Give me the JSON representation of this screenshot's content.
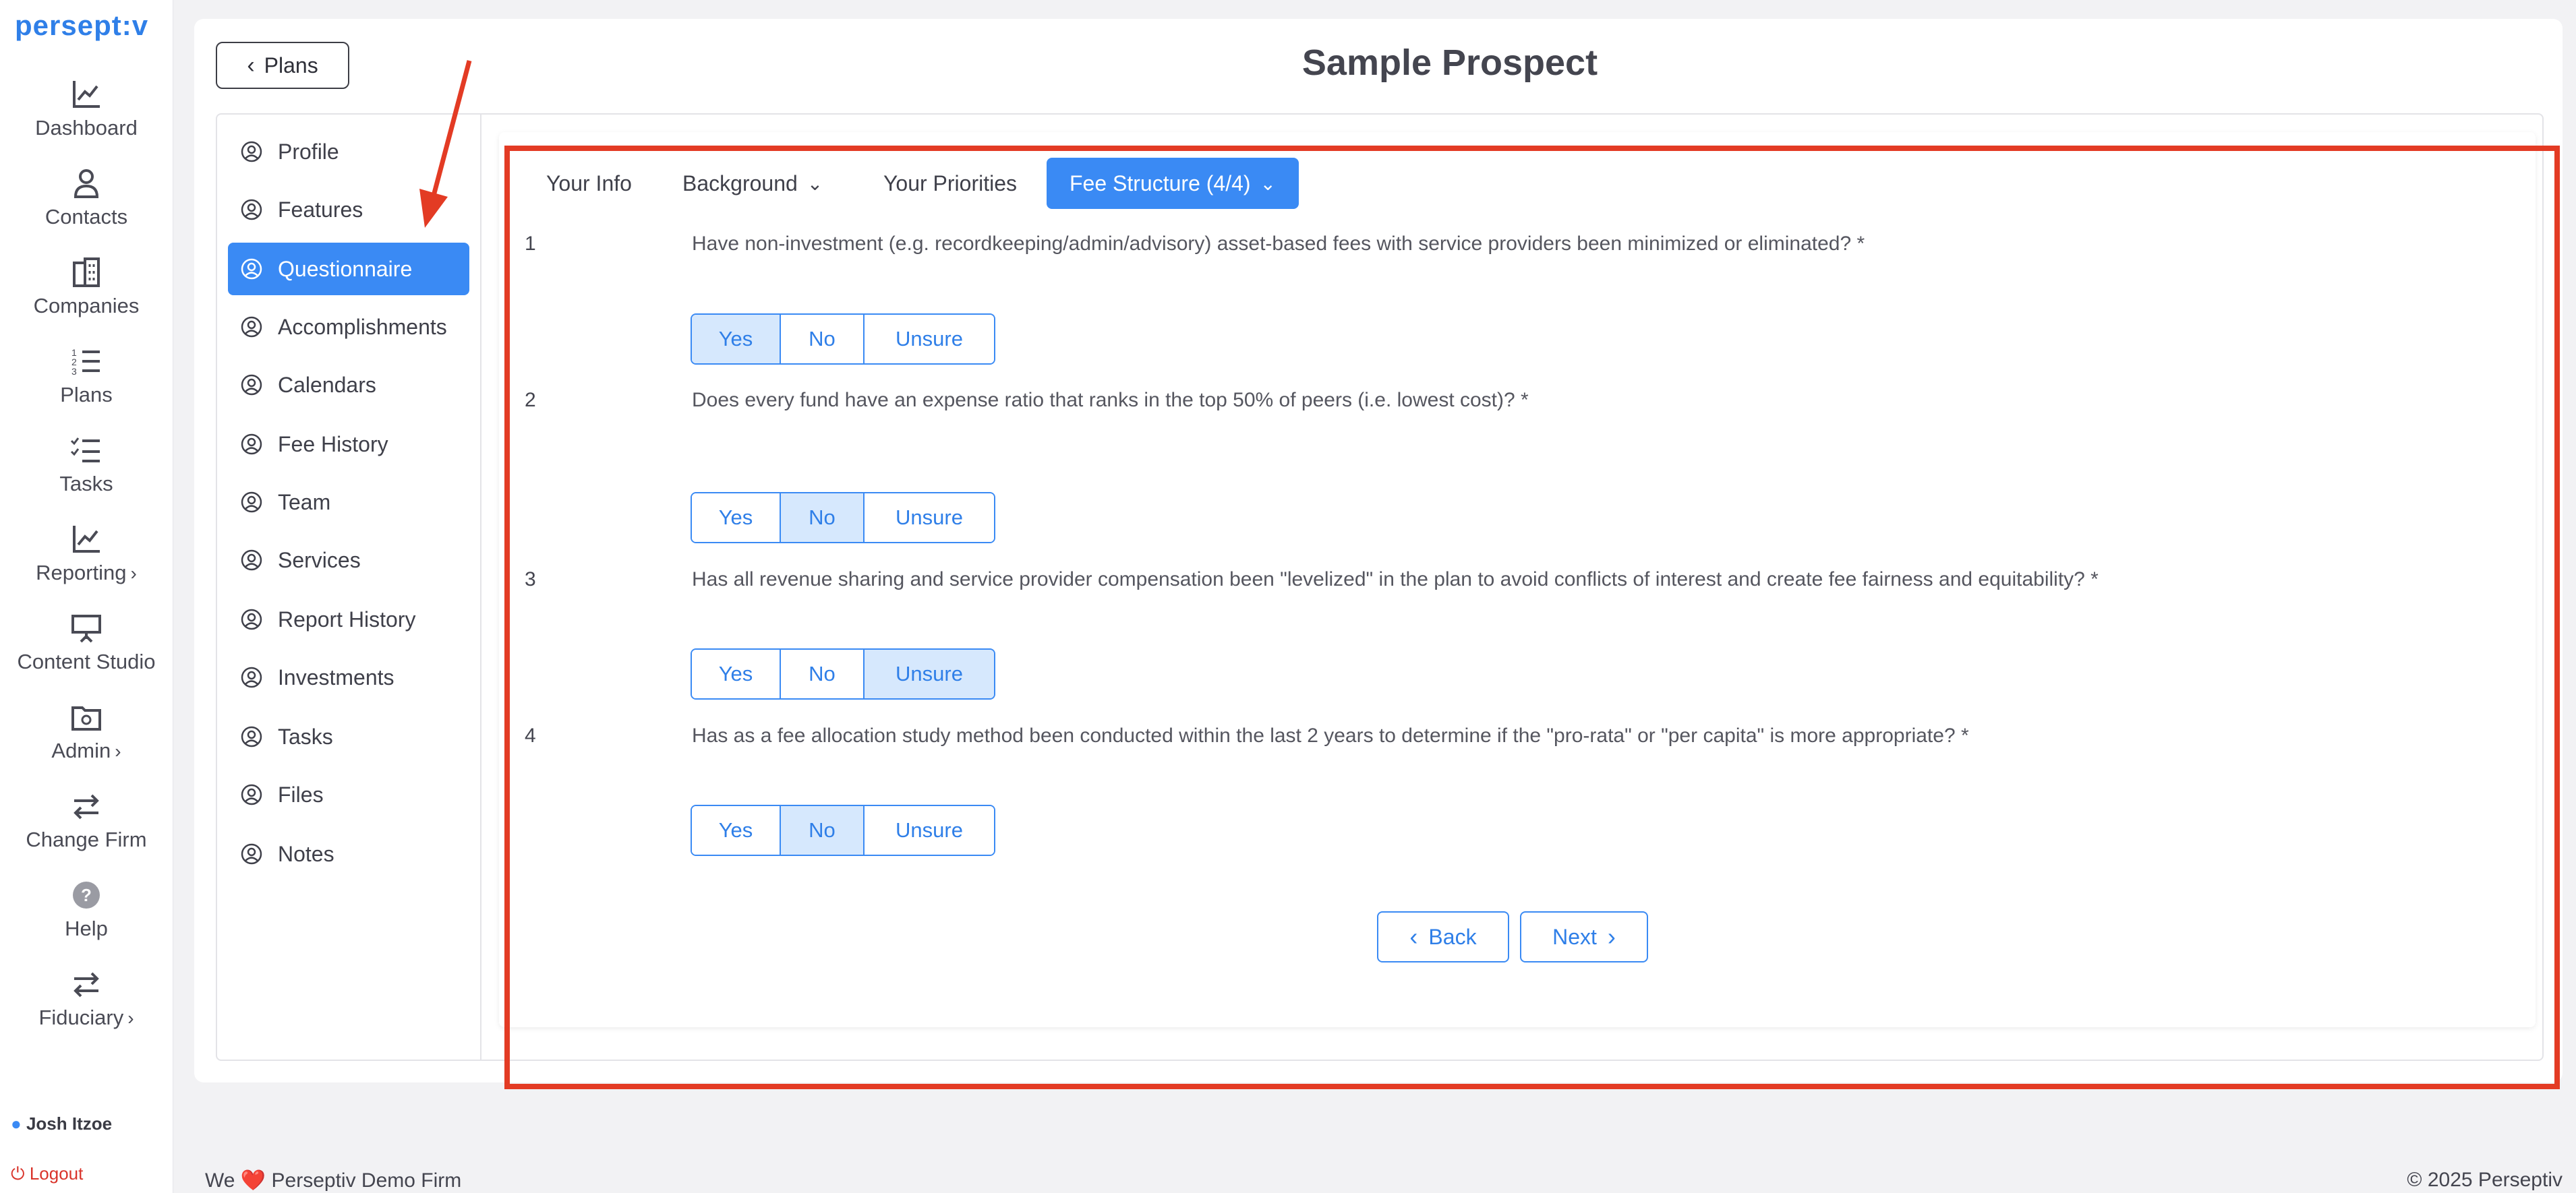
{
  "app": {
    "logo": "persept:v",
    "nav": [
      {
        "label": "Dashboard",
        "icon": "chart-line-icon"
      },
      {
        "label": "Contacts",
        "icon": "person-icon"
      },
      {
        "label": "Companies",
        "icon": "building-icon"
      },
      {
        "label": "Plans",
        "icon": "numbered-list-icon"
      },
      {
        "label": "Tasks",
        "icon": "checklist-icon"
      },
      {
        "label": "Reporting",
        "icon": "chart-line-icon",
        "chevron": "›"
      },
      {
        "label": "Content Studio",
        "icon": "presentation-icon"
      },
      {
        "label": "Admin",
        "icon": "folder-gear-icon",
        "chevron": "›"
      },
      {
        "label": "Change Firm",
        "icon": "swap-arrows-icon"
      },
      {
        "label": "Help",
        "icon": "question-circle-icon"
      },
      {
        "label": "Fiduciary",
        "icon": "swap-arrows-icon",
        "chevron": "›"
      }
    ],
    "user": "Josh Itzoe",
    "logout": "Logout"
  },
  "header": {
    "back_label": "Plans",
    "title": "Sample Prospect"
  },
  "side_menu": [
    "Profile",
    "Features",
    "Questionnaire",
    "Accomplishments",
    "Calendars",
    "Fee History",
    "Team",
    "Services",
    "Report History",
    "Investments",
    "Tasks",
    "Files",
    "Notes"
  ],
  "side_menu_active": "Questionnaire",
  "tabs": [
    {
      "label": "Your Info",
      "dropdown": false,
      "active": false
    },
    {
      "label": "Background",
      "dropdown": true,
      "active": false
    },
    {
      "label": "Your Priorities",
      "dropdown": false,
      "active": false
    },
    {
      "label": "Fee Structure (4/4)",
      "dropdown": true,
      "active": true
    }
  ],
  "questions": [
    {
      "num": "1",
      "text": "Have non-investment (e.g. recordkeeping/admin/advisory) asset-based fees with service providers been minimized or eliminated? *",
      "selected": "Yes"
    },
    {
      "num": "2",
      "text": "Does every fund have an expense ratio that ranks in the top 50% of peers (i.e. lowest cost)? *",
      "selected": "No"
    },
    {
      "num": "3",
      "text": "Has all revenue sharing and service provider compensation been \"levelized\" in the plan to avoid conflicts of interest and create fee fairness and equitability? *",
      "selected": "Unsure"
    },
    {
      "num": "4",
      "text": "Has as a fee allocation study method been conducted within the last 2 years to determine if the \"pro-rata\" or \"per capita\" is more appropriate? *",
      "selected": "No"
    }
  ],
  "options": [
    "Yes",
    "No",
    "Unsure"
  ],
  "buttons": {
    "back": "Back",
    "next": "Next"
  },
  "footer": {
    "left_prefix": "We",
    "left_heart": "❤️",
    "left_suffix": "Perseptiv Demo Firm",
    "right": "© 2025 Perseptiv"
  },
  "colors": {
    "accent": "#3a8af4",
    "selected_fill": "#d6e8fd",
    "annotation": "#e33b24"
  }
}
